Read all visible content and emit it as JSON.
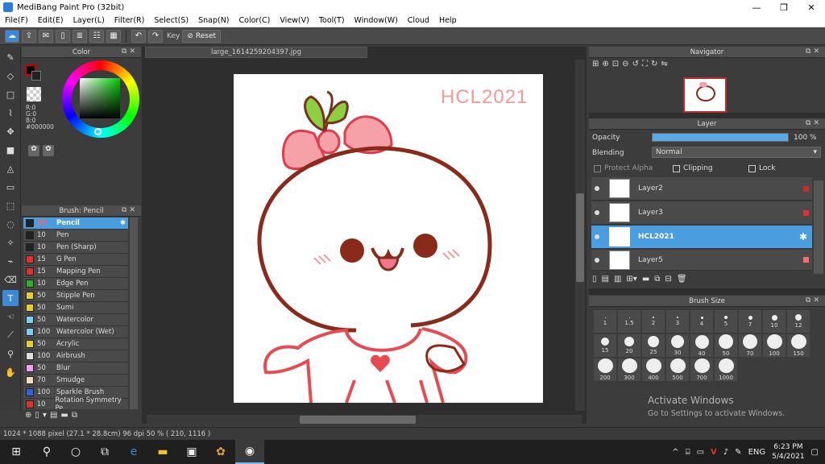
{
  "window": {
    "title": "MediBang Paint Pro (32bit)",
    "minimize": "—",
    "maximize": "❐",
    "close": "✕"
  },
  "menu": [
    "File(F)",
    "Edit(E)",
    "Layer(L)",
    "Filter(R)",
    "Select(S)",
    "Snap(N)",
    "Color(C)",
    "View(V)",
    "Tool(T)",
    "Window(W)",
    "Cloud",
    "Help"
  ],
  "toolbar": {
    "key_label": "Key",
    "reset_label": "Reset"
  },
  "color_panel": {
    "title": "Color",
    "r": "R:0",
    "g": "G:0",
    "b": "B:0",
    "hex": "#000000"
  },
  "brush_panel": {
    "title": "Brush: Pencil",
    "brushes": [
      {
        "size": "30",
        "name": "Pencil",
        "color": "#222222"
      },
      {
        "size": "10",
        "name": "Pen",
        "color": "#222222"
      },
      {
        "size": "10",
        "name": "Pen (Sharp)",
        "color": "#222222"
      },
      {
        "size": "15",
        "name": "G Pen",
        "color": "#e03030"
      },
      {
        "size": "15",
        "name": "Mapping Pen",
        "color": "#e03030"
      },
      {
        "size": "10",
        "name": "Edge Pen",
        "color": "#2ab02a"
      },
      {
        "size": "50",
        "name": "Stipple Pen",
        "color": "#e8d020"
      },
      {
        "size": "50",
        "name": "Sumi",
        "color": "#e8d020"
      },
      {
        "size": "50",
        "name": "Watercolor",
        "color": "#7ad0f0"
      },
      {
        "size": "100",
        "name": "Watercolor (Wet)",
        "color": "#7ad0f0"
      },
      {
        "size": "50",
        "name": "Acrylic",
        "color": "#e8d020"
      },
      {
        "size": "100",
        "name": "Airbrush",
        "color": "#dddddd"
      },
      {
        "size": "50",
        "name": "Blur",
        "color": "#f0a0f0"
      },
      {
        "size": "70",
        "name": "Smudge",
        "color": "#f0dcc0"
      },
      {
        "size": "100",
        "name": "Sparkle Brush",
        "color": "#3060e0"
      },
      {
        "size": "10",
        "name": "Rotation Symmetry Pe",
        "color": "#e03030"
      }
    ]
  },
  "canvas": {
    "tab": "large_1614259204397.jpg",
    "watermark": "HCL2021"
  },
  "navigator": {
    "title": "Navigator"
  },
  "layer_panel": {
    "title": "Layer",
    "opacity_label": "Opacity",
    "opacity_value": "100 %",
    "opacity_fraction": 1.0,
    "blending_label": "Blending",
    "blending_value": "Normal",
    "protect_alpha": "Protect Alpha",
    "clipping": "Clipping",
    "lock": "Lock",
    "layers": [
      {
        "name": "Layer2",
        "selected": false
      },
      {
        "name": "Layer3",
        "selected": false
      },
      {
        "name": "HCL2021",
        "selected": true
      },
      {
        "name": "Layer5",
        "selected": false
      }
    ]
  },
  "brush_size": {
    "title": "Brush Size",
    "sizes": [
      "1",
      "1.5",
      "2",
      "3",
      "4",
      "5",
      "7",
      "10",
      "12",
      "15",
      "20",
      "25",
      "30",
      "40",
      "50",
      "70",
      "100",
      "150",
      "200",
      "300",
      "400",
      "500",
      "700",
      "1000"
    ]
  },
  "watermark": {
    "line1": "Activate Windows",
    "line2": "Go to Settings to activate Windows."
  },
  "status": {
    "text": "1024 * 1088 pixel   (27.1 * 28.8cm)   96 dpi   50 %   ( 210, 1116 )"
  },
  "taskbar": {
    "lang": "ENG",
    "time": "6:23 PM",
    "date": "5/4/2021"
  }
}
